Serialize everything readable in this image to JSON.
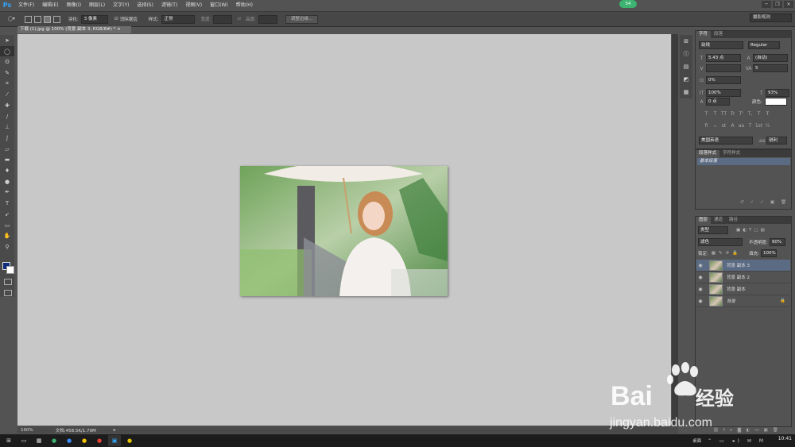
{
  "app": {
    "logo": "Ps",
    "badge": "54"
  },
  "menu": [
    "文件(F)",
    "编辑(E)",
    "图像(I)",
    "图层(L)",
    "文字(Y)",
    "选择(S)",
    "滤镜(T)",
    "视图(V)",
    "窗口(W)",
    "帮助(H)"
  ],
  "window_buttons": [
    "─",
    "❐",
    "✕"
  ],
  "options": {
    "feather_label": "羽化:",
    "feather_value": "3 像素",
    "antialias_label": "消除锯齿",
    "style_label": "样式:",
    "style_value": "正常",
    "width_label": "宽度:",
    "height_label": "高度:",
    "refine_button": "调整边缘...",
    "workspace": "摄影规则"
  },
  "document": {
    "tab_title": "下载 (1).jpg @ 100% (背景 副本 3, RGB/8#) *",
    "zoom": "100%",
    "doc_info": "文档:458.5K/1.79M"
  },
  "character_panel": {
    "tabs": [
      "字符",
      "段落"
    ],
    "font_family": "幼线",
    "font_style": "Regular",
    "font_size": "5.43 点",
    "leading": "(自动)",
    "tracking": "5",
    "scale_percent": "0%",
    "vertical_scale": "100%",
    "horizontal_scale": "93%",
    "baseline_shift": "0 点",
    "color_label": "颜色:",
    "text_style_glyphs": [
      "T",
      "T",
      "TT",
      "Tr",
      "T'",
      "T,",
      "T",
      "Ŧ"
    ],
    "opentype_glyphs": [
      "fi",
      "ℴ",
      "st",
      "A",
      "aa",
      "T",
      "1st",
      "½"
    ],
    "language": "美国英语",
    "antialias": "锐利"
  },
  "paragraph_style_panel": {
    "tabs": [
      "段落样式",
      "字符样式"
    ],
    "item": "基本段落"
  },
  "layers_panel": {
    "tabs": [
      "图层",
      "通道",
      "路径"
    ],
    "filter_kind": "类型",
    "blend_mode": "滤色",
    "opacity_label": "不透明度:",
    "opacity": "90%",
    "lock_label": "锁定:",
    "fill_label": "填充:",
    "fill": "100%",
    "layers": [
      {
        "name": "背景 副本 3",
        "selected": true
      },
      {
        "name": "背景 副本 2",
        "selected": false
      },
      {
        "name": "背景 副本",
        "selected": false
      },
      {
        "name": "背景",
        "selected": false,
        "locked": true
      }
    ]
  },
  "taskbar": {
    "tray_label": "桌面",
    "time": "10:41"
  },
  "watermark": {
    "brand": "Bai",
    "brand2": "经验",
    "url": "jingyan.baidu.com"
  },
  "colors": {
    "accent": "#31a8ff",
    "selection": "#5b6b84",
    "canvas_bg": "#c8c8c8",
    "badge": "#3cb371"
  }
}
